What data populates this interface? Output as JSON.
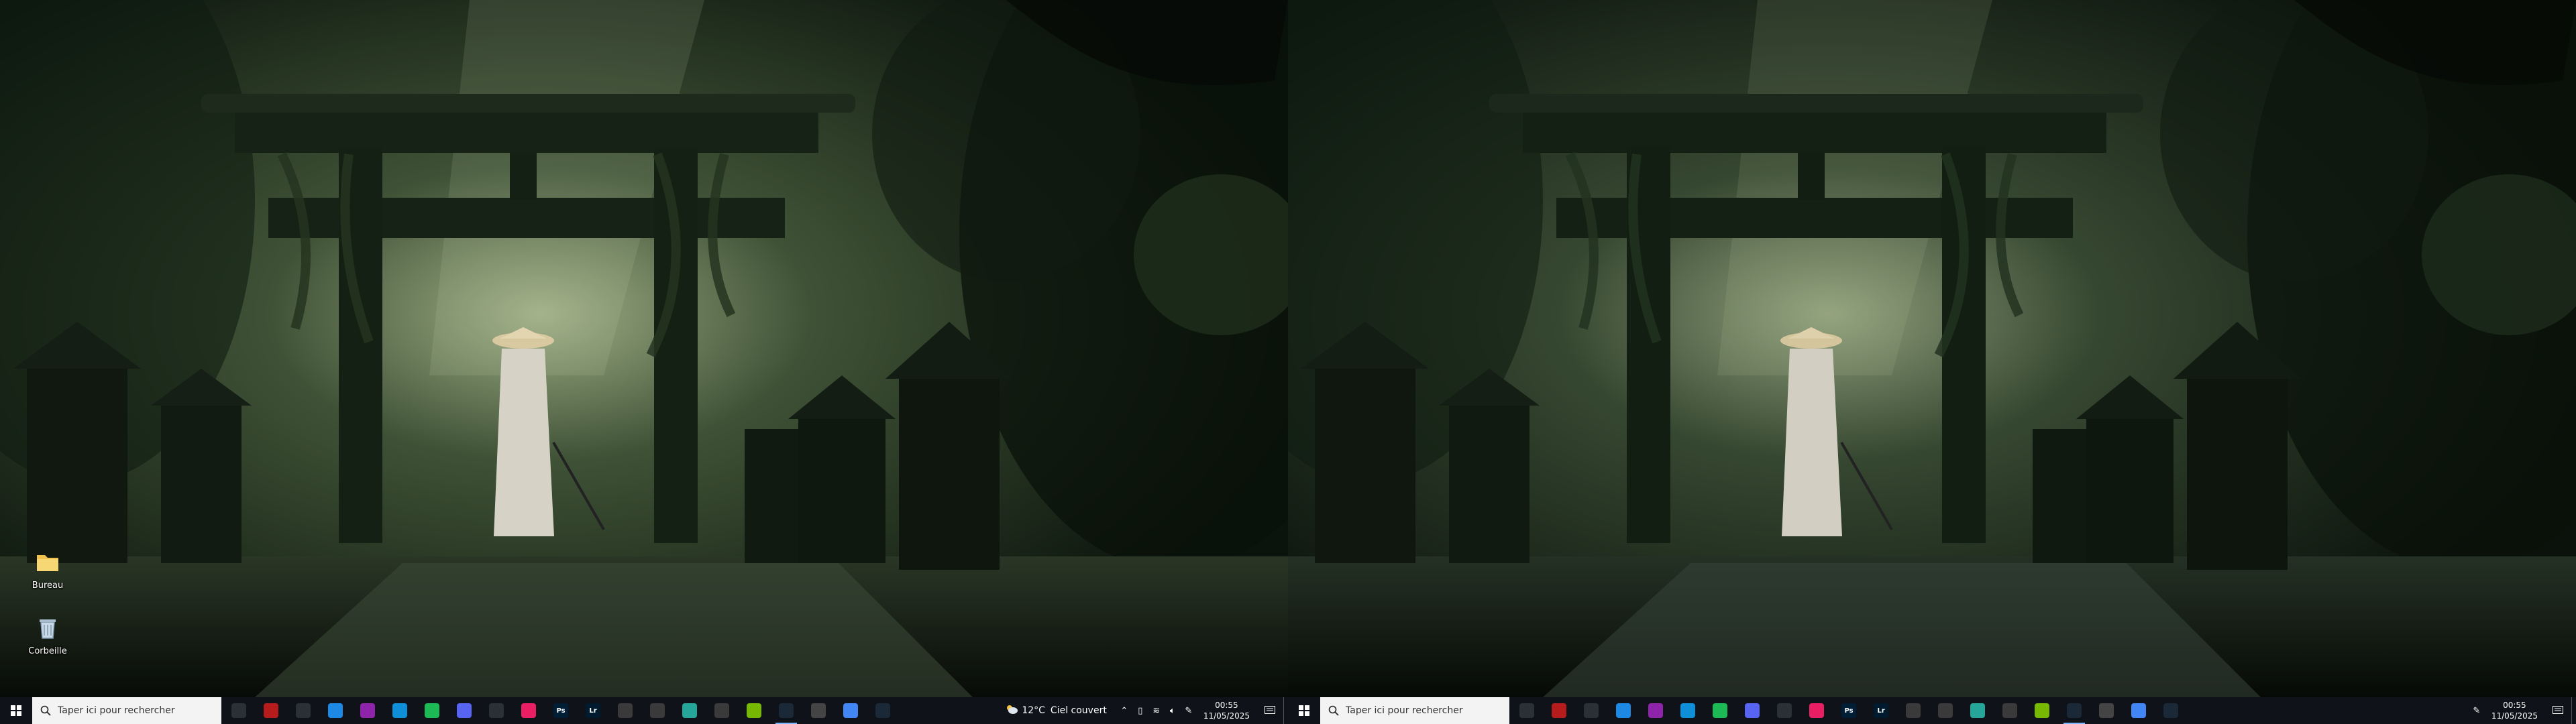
{
  "desktop": {
    "icons": [
      {
        "label": "Bureau",
        "icon": "folder-icon"
      },
      {
        "label": "Corbeille",
        "icon": "recycle-bin-icon"
      }
    ]
  },
  "taskbar": {
    "search_placeholder": "Taper ici pour rechercher",
    "apps": [
      {
        "name": "task-view-icon",
        "color": "#2b2f36"
      },
      {
        "name": "game-controller-icon",
        "color": "#b71c1c"
      },
      {
        "name": "settings-icon",
        "color": "#2b2f36"
      },
      {
        "name": "calendar-icon",
        "color": "#1e88e5"
      },
      {
        "name": "multicolor-app-icon",
        "color": "#8e24aa"
      },
      {
        "name": "edge-icon",
        "color": "#0f8fd8"
      },
      {
        "name": "spotify-icon",
        "color": "#1db954"
      },
      {
        "name": "discord-icon",
        "color": "#5865f2"
      },
      {
        "name": "triangle-app-icon",
        "color": "#2b2f36"
      },
      {
        "name": "color-wheel-icon",
        "color": "#e91e63"
      },
      {
        "name": "photoshop-icon",
        "color": "#001e36",
        "text": "Ps"
      },
      {
        "name": "lightroom-icon",
        "color": "#001a2e",
        "text": "Lr"
      },
      {
        "name": "obs-icon",
        "color": "#3a3a3a"
      },
      {
        "name": "terminal-icon",
        "color": "#3a3a3a"
      },
      {
        "name": "teal-app-icon",
        "color": "#26a69a"
      },
      {
        "name": "github-icon",
        "color": "#3a3a3a"
      },
      {
        "name": "nvidia-icon",
        "color": "#76b900"
      },
      {
        "name": "steam-icon",
        "color": "#1b2838"
      },
      {
        "name": "github-desktop-icon",
        "color": "#444"
      },
      {
        "name": "chrome-icon",
        "color": "#4285f4"
      },
      {
        "name": "steam-icon-2",
        "color": "#1b2838"
      }
    ],
    "active_app_index": 17,
    "weather": {
      "temp": "12°C",
      "desc": "Ciel couvert"
    },
    "clock": {
      "time": "00:55",
      "date": "11/05/2025"
    }
  }
}
